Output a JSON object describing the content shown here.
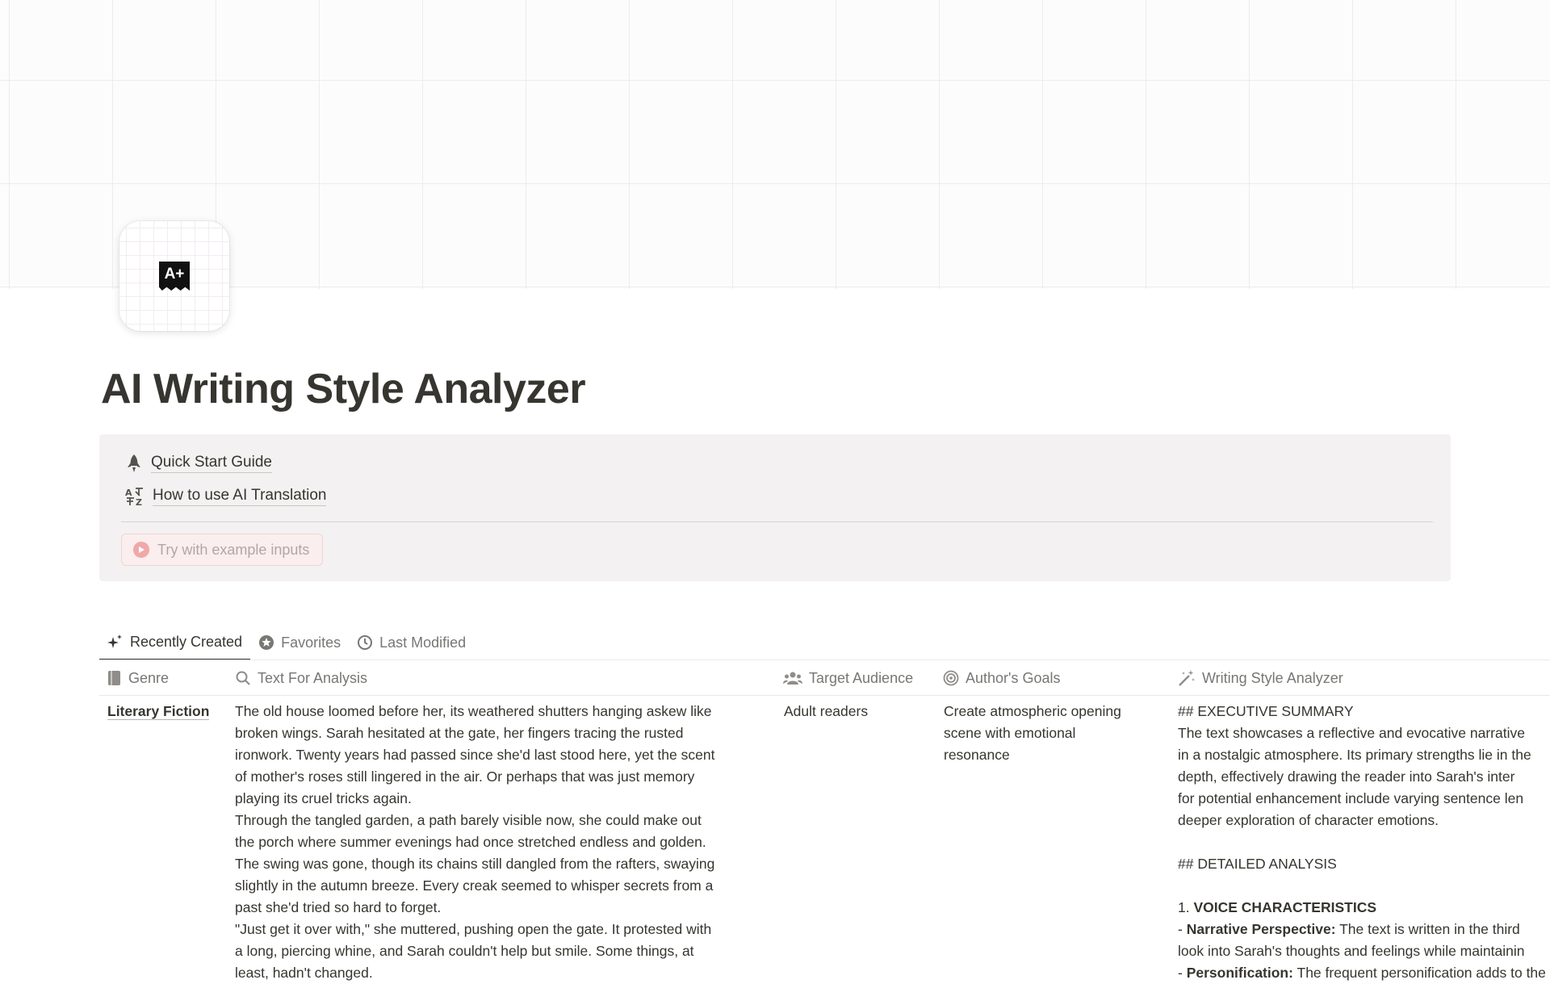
{
  "page": {
    "title": "AI Writing Style Analyzer",
    "icon": "a-plus-grade-icon",
    "icon_text": "A+"
  },
  "callout": {
    "links": [
      {
        "icon": "rocket-icon",
        "label": "Quick Start Guide"
      },
      {
        "icon": "translate-icon",
        "label": "How to use AI Translation"
      }
    ],
    "try_button": {
      "icon": "play-circle-icon",
      "label": "Try with example inputs"
    }
  },
  "tabs": [
    {
      "icon": "sparkles-icon",
      "label": "Recently Created",
      "active": true
    },
    {
      "icon": "star-icon",
      "label": "Favorites",
      "active": false
    },
    {
      "icon": "clock-icon",
      "label": "Last Modified",
      "active": false
    }
  ],
  "table": {
    "columns": [
      {
        "icon": "book-icon",
        "label": "Genre"
      },
      {
        "icon": "search-icon",
        "label": "Text For Analysis"
      },
      {
        "icon": "people-icon",
        "label": "Target Audience"
      },
      {
        "icon": "target-icon",
        "label": "Author's Goals"
      },
      {
        "icon": "magic-wand-icon",
        "label": "Writing Style Analyzer"
      }
    ],
    "row": {
      "genre": "Literary Fiction",
      "text_lines": [
        "The old house loomed before her, its weathered shutters hanging askew like",
        "broken wings. Sarah hesitated at the gate, her fingers tracing the rusted",
        "ironwork. Twenty years had passed since she'd last stood here, yet the scent",
        "of mother's roses still lingered in the air. Or perhaps that was just memory",
        "playing its cruel tricks again.",
        "Through the tangled garden, a path barely visible now, she could make out",
        "the porch where summer evenings had once stretched endless and golden.",
        "The swing was gone, though its chains still dangled from the rafters, swaying",
        "slightly in the autumn breeze. Every creak seemed to whisper secrets from a",
        "past she'd tried so hard to forget.",
        "\"Just get it over with,\" she muttered, pushing open the gate. It protested with",
        "a long, piercing whine, and Sarah couldn't help but smile. Some things, at",
        "least, hadn't changed."
      ],
      "audience": "Adult readers",
      "goals_lines": [
        "Create atmospheric opening",
        "scene with emotional",
        "resonance"
      ],
      "analysis": {
        "exec_heading": "## EXECUTIVE SUMMARY",
        "exec_lines": [
          "The text showcases a reflective and evocative narrative",
          "in a nostalgic atmosphere. Its primary strengths lie in the",
          "depth, effectively drawing the reader into Sarah's inter",
          "for potential enhancement include varying sentence len",
          "deeper exploration of character emotions."
        ],
        "detail_heading": "## DETAILED ANALYSIS",
        "voice_num": "1. ",
        "voice_heading": "VOICE CHARACTERISTICS",
        "bullet1_prefix": "- ",
        "bullet1_bold": "Narrative Perspective:",
        "bullet1_text": " The text is written in the third",
        "bullet1_line2": "look into Sarah's thoughts and feelings while maintainin",
        "bullet2_prefix": "- ",
        "bullet2_bold": "Personification:",
        "bullet2_text": " The frequent personification adds to the"
      }
    }
  }
}
